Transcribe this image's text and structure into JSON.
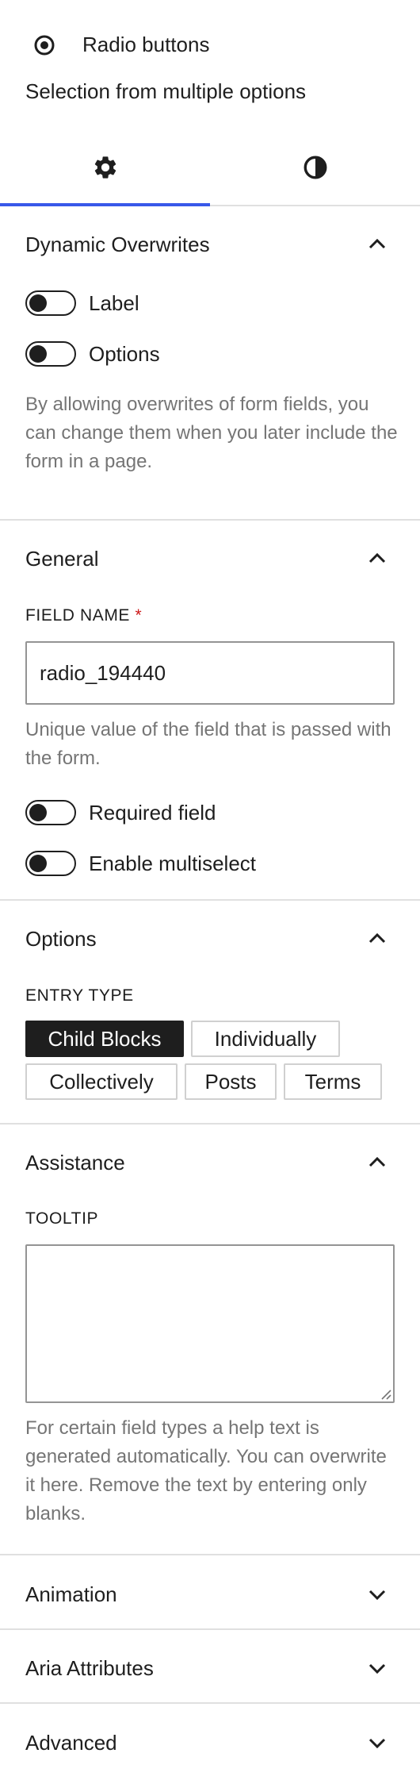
{
  "block": {
    "title": "Radio buttons",
    "description": "Selection from multiple options",
    "icon": "radio-button-icon"
  },
  "tabs": [
    {
      "name": "settings",
      "icon": "gear-icon",
      "active": true
    },
    {
      "name": "styles",
      "icon": "contrast-icon",
      "active": false
    }
  ],
  "accent_color": "#3858e9",
  "dynamic_overwrites": {
    "title": "Dynamic Overwrites",
    "expanded": true,
    "toggles": [
      {
        "label": "Label",
        "checked": false
      },
      {
        "label": "Options",
        "checked": false
      }
    ],
    "help": "By allowing overwrites of form fields, you can change them when you later include the form in a page."
  },
  "general": {
    "title": "General",
    "expanded": true,
    "field_name_label": "FIELD NAME",
    "required_marker": "*",
    "field_name_value": "radio_194440",
    "field_name_help": "Unique value of the field that is passed with the form.",
    "toggles": [
      {
        "label": "Required field",
        "checked": false
      },
      {
        "label": "Enable multiselect",
        "checked": false
      }
    ]
  },
  "options": {
    "title": "Options",
    "expanded": true,
    "entry_type_label": "ENTRY TYPE",
    "entry_types": [
      {
        "label": "Child Blocks",
        "selected": true
      },
      {
        "label": "Individually",
        "selected": false
      },
      {
        "label": "Collectively",
        "selected": false
      },
      {
        "label": "Posts",
        "selected": false
      },
      {
        "label": "Terms",
        "selected": false
      }
    ]
  },
  "assistance": {
    "title": "Assistance",
    "expanded": true,
    "tooltip_label": "TOOLTIP",
    "tooltip_value": "",
    "help": "For certain field types a help text is generated automatically. You can overwrite it here. Remove the text by entering only blanks."
  },
  "collapsed_panels": [
    {
      "title": "Animation",
      "expanded": false
    },
    {
      "title": "Aria Attributes",
      "expanded": false
    },
    {
      "title": "Advanced",
      "expanded": false
    }
  ]
}
